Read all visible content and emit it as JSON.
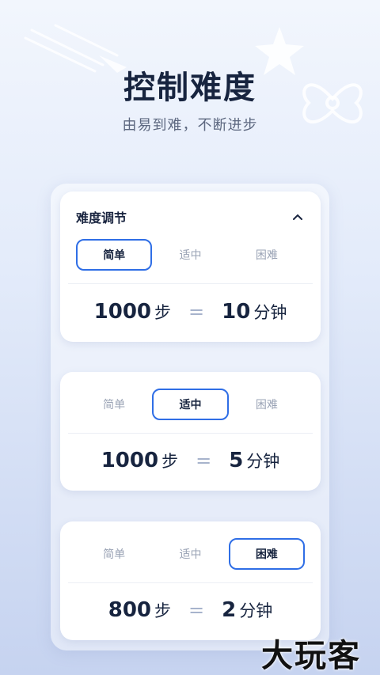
{
  "header": {
    "title": "控制难度",
    "subtitle": "由易到难，不断进步"
  },
  "difficulty_card": {
    "title": "难度调节",
    "tabs": [
      "简单",
      "适中",
      "困难"
    ]
  },
  "levels": [
    {
      "selected": "简单",
      "steps": "1000",
      "steps_unit": "步",
      "equals": "=",
      "minutes": "10",
      "minutes_unit": "分钟"
    },
    {
      "selected": "适中",
      "steps": "1000",
      "steps_unit": "步",
      "equals": "=",
      "minutes": "5",
      "minutes_unit": "分钟"
    },
    {
      "selected": "困难",
      "steps": "800",
      "steps_unit": "步",
      "equals": "=",
      "minutes": "2",
      "minutes_unit": "分钟"
    }
  ],
  "icons": {
    "collapse": "chevron-up-icon"
  },
  "colors": {
    "accent": "#2f6ee6",
    "text": "#17243f",
    "muted": "#9aa3b5"
  },
  "watermark": "大玩客"
}
